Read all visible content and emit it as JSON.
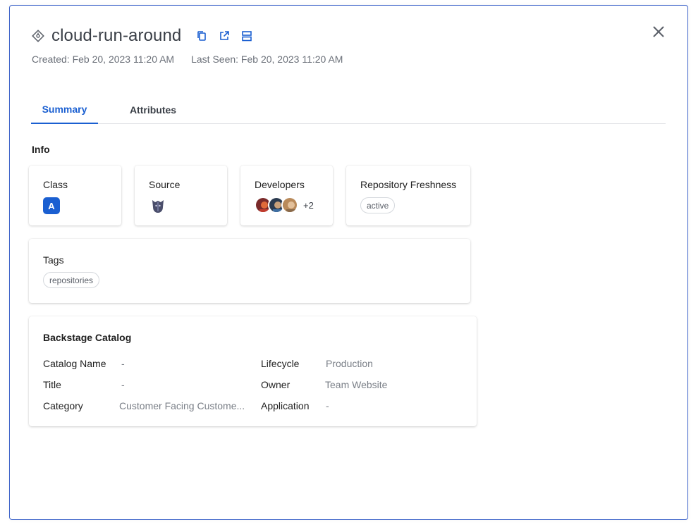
{
  "entity": {
    "title": "cloud-run-around",
    "icon": "git-commit-diamond-icon",
    "created": "Created: Feb 20, 2023 11:20 AM",
    "last_seen": "Last Seen: Feb 20, 2023 11:20 AM",
    "actions": [
      "copy-icon",
      "open-external-icon",
      "split-view-icon"
    ]
  },
  "tabs": [
    {
      "label": "Summary",
      "active": true
    },
    {
      "label": "Attributes",
      "active": false
    }
  ],
  "info": {
    "label": "Info",
    "class": {
      "label": "Class",
      "value": "A"
    },
    "source": {
      "label": "Source",
      "icon": "ghost-logo-icon"
    },
    "developers": {
      "label": "Developers",
      "extra_count": "+2"
    },
    "freshness": {
      "label": "Repository Freshness",
      "value": "active"
    },
    "tags": {
      "label": "Tags",
      "items": [
        "repositories"
      ]
    }
  },
  "catalog": {
    "title": "Backstage Catalog",
    "fields": {
      "catalog_name": {
        "label": "Catalog Name",
        "value": "-"
      },
      "title": {
        "label": "Title",
        "value": "-"
      },
      "category": {
        "label": "Category",
        "value": "Customer Facing Custome..."
      },
      "lifecycle": {
        "label": "Lifecycle",
        "value": "Production"
      },
      "owner": {
        "label": "Owner",
        "value": "Team Website"
      },
      "application": {
        "label": "Application",
        "value": "-"
      }
    }
  },
  "colors": {
    "accent": "#1a5fd1",
    "border": "#3d63c9",
    "muted_text": "#6b7079"
  }
}
